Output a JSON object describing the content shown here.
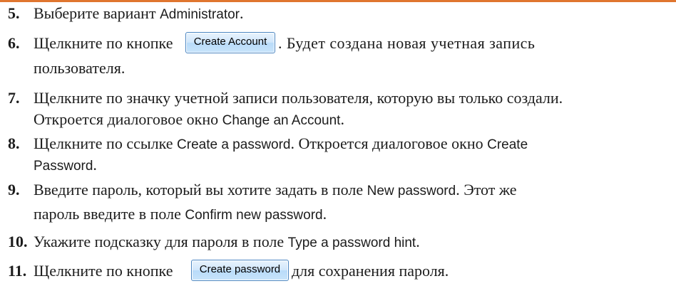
{
  "steps": [
    {
      "number": "5.",
      "lines": [
        {
          "parts": [
            {
              "t": "Выберите вариант ",
              "ui": false
            },
            {
              "t": "Administrator",
              "ui": true
            },
            {
              "t": ".",
              "ui": false
            }
          ]
        }
      ]
    },
    {
      "number": "6.",
      "lines": [
        {
          "text_before": "Щелкните по кнопке",
          "button": "Create Account",
          "text_after": ". Будет создана новая учетная запись"
        },
        {
          "text": "пользователя."
        }
      ]
    },
    {
      "number": "7.",
      "lines": [
        {
          "text": "Щелкните по значку учетной записи пользователя, которую вы только создали."
        },
        {
          "parts": [
            {
              "t": "Откроется диалоговое окно ",
              "ui": false
            },
            {
              "t": "Change an Account",
              "ui": true
            },
            {
              "t": ".",
              "ui": false
            }
          ]
        }
      ]
    },
    {
      "number": "8.",
      "lines": [
        {
          "parts": [
            {
              "t": "Щелкните по ссылке ",
              "ui": false
            },
            {
              "t": "Create a password",
              "ui": true
            },
            {
              "t": ". Откроется диалоговое окно ",
              "ui": false
            },
            {
              "t": "Create",
              "ui": true
            }
          ]
        },
        {
          "parts": [
            {
              "t": "Password",
              "ui": true
            },
            {
              "t": ".",
              "ui": false
            }
          ]
        }
      ]
    },
    {
      "number": "9.",
      "lines": [
        {
          "parts": [
            {
              "t": "Введите пароль, который вы хотите задать в поле ",
              "ui": false
            },
            {
              "t": "New password",
              "ui": true
            },
            {
              "t": ". Этот же",
              "ui": false
            }
          ]
        },
        {
          "parts": [
            {
              "t": "пароль введите в поле ",
              "ui": false
            },
            {
              "t": "Confirm new password",
              "ui": true
            },
            {
              "t": ".",
              "ui": false
            }
          ]
        }
      ]
    },
    {
      "number": "10.",
      "lines": [
        {
          "parts": [
            {
              "t": "Укажите подсказку для пароля в поле ",
              "ui": false
            },
            {
              "t": "Type a password hint",
              "ui": true
            },
            {
              "t": ".",
              "ui": false
            }
          ]
        }
      ]
    },
    {
      "number": "11.",
      "lines": [
        {
          "text_before": "Щелкните по кнопке",
          "button": "Create password",
          "text_after": "для сохранения пароля."
        }
      ]
    }
  ]
}
